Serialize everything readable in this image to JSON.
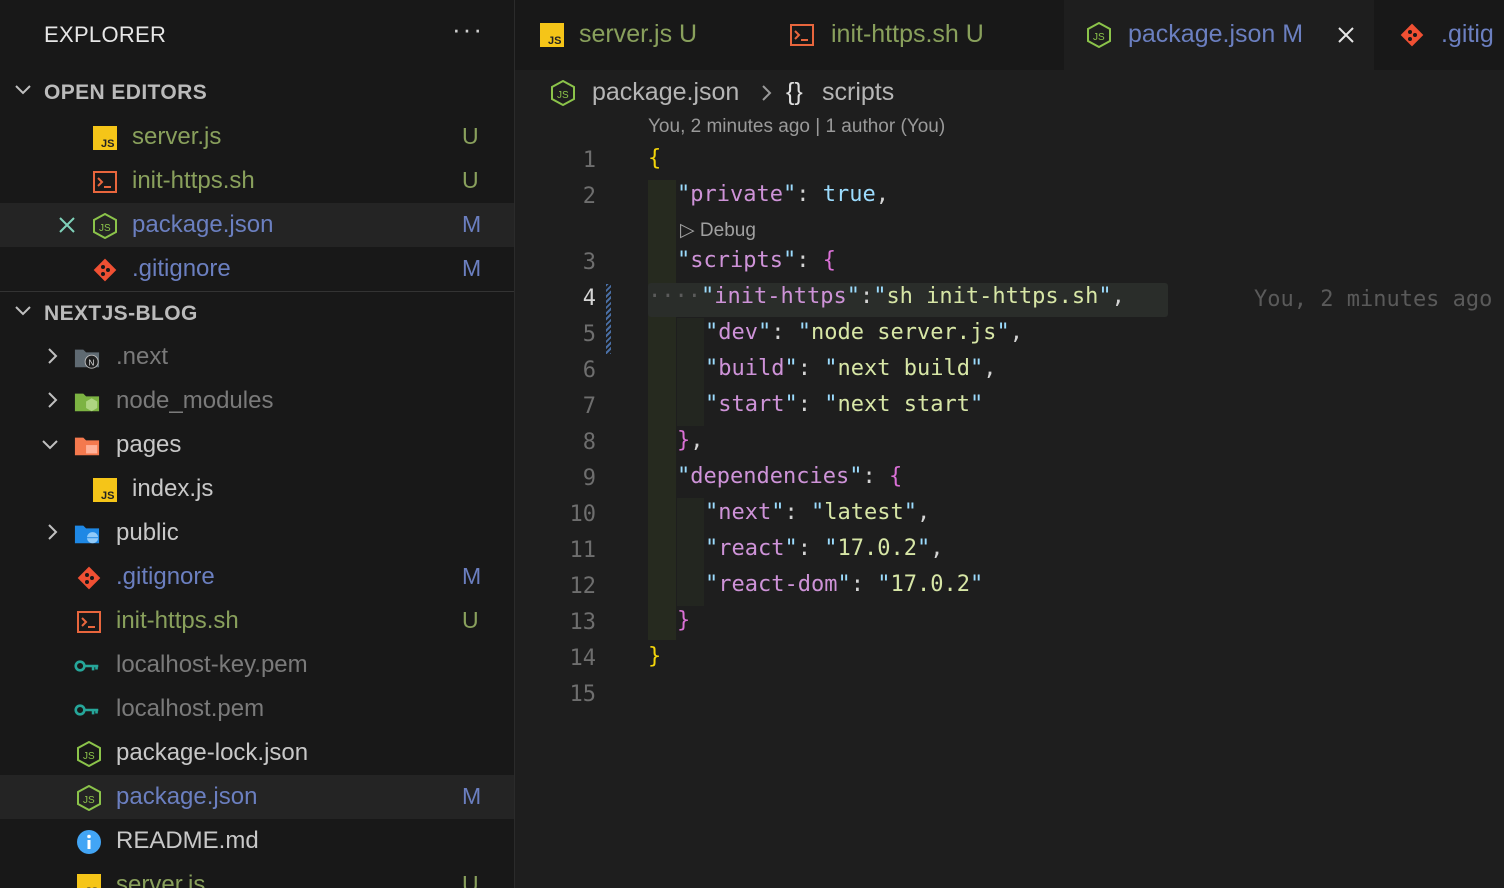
{
  "sidebar": {
    "title": "EXPLORER",
    "more": "···",
    "open_editors": {
      "label": "OPEN EDITORS",
      "items": [
        {
          "name": "server.js",
          "badge": "U"
        },
        {
          "name": "init-https.sh",
          "badge": "U"
        },
        {
          "name": "package.json",
          "badge": "M"
        },
        {
          "name": ".gitignore",
          "badge": "M"
        }
      ]
    },
    "project": {
      "label": "NEXTJS-BLOG",
      "items": [
        {
          "name": ".next",
          "badge": ""
        },
        {
          "name": "node_modules",
          "badge": ""
        },
        {
          "name": "pages",
          "badge": ""
        },
        {
          "name": "index.js",
          "badge": ""
        },
        {
          "name": "public",
          "badge": ""
        },
        {
          "name": ".gitignore",
          "badge": "M"
        },
        {
          "name": "init-https.sh",
          "badge": "U"
        },
        {
          "name": "localhost-key.pem",
          "badge": ""
        },
        {
          "name": "localhost.pem",
          "badge": ""
        },
        {
          "name": "package-lock.json",
          "badge": ""
        },
        {
          "name": "package.json",
          "badge": "M"
        },
        {
          "name": "README.md",
          "badge": ""
        },
        {
          "name": "server.js",
          "badge": "U"
        }
      ]
    }
  },
  "tabs": [
    {
      "name": "server.js",
      "badge": "U"
    },
    {
      "name": "init-https.sh",
      "badge": "U"
    },
    {
      "name": "package.json",
      "badge": "M"
    },
    {
      "name": ".gitig",
      "badge": ""
    }
  ],
  "breadcrumb": {
    "file": "package.json",
    "symbol": "scripts",
    "symbol_icon": "{}"
  },
  "blame": {
    "header": "You, 2 minutes ago | 1 author (You)",
    "inline": "You, 2 minutes ago"
  },
  "codelens": {
    "debug": "Debug"
  },
  "line_numbers": [
    "1",
    "2",
    "3",
    "4",
    "5",
    "6",
    "7",
    "8",
    "9",
    "10",
    "11",
    "12",
    "13",
    "14",
    "15"
  ],
  "code": {
    "l1": "{",
    "l2_key": "private",
    "l2_val": "true",
    "l3_key": "scripts",
    "l4_key": "init-https",
    "l4_val": "sh init-https.sh",
    "l5_key": "dev",
    "l5_val": "node server.js",
    "l6_key": "build",
    "l6_val": "next build",
    "l7_key": "start",
    "l7_val": "next start",
    "l9_key": "dependencies",
    "l10_key": "next",
    "l10_val": "latest",
    "l11_key": "react",
    "l11_val": "17.0.2",
    "l12_key": "react-dom",
    "l12_val": "17.0.2"
  }
}
